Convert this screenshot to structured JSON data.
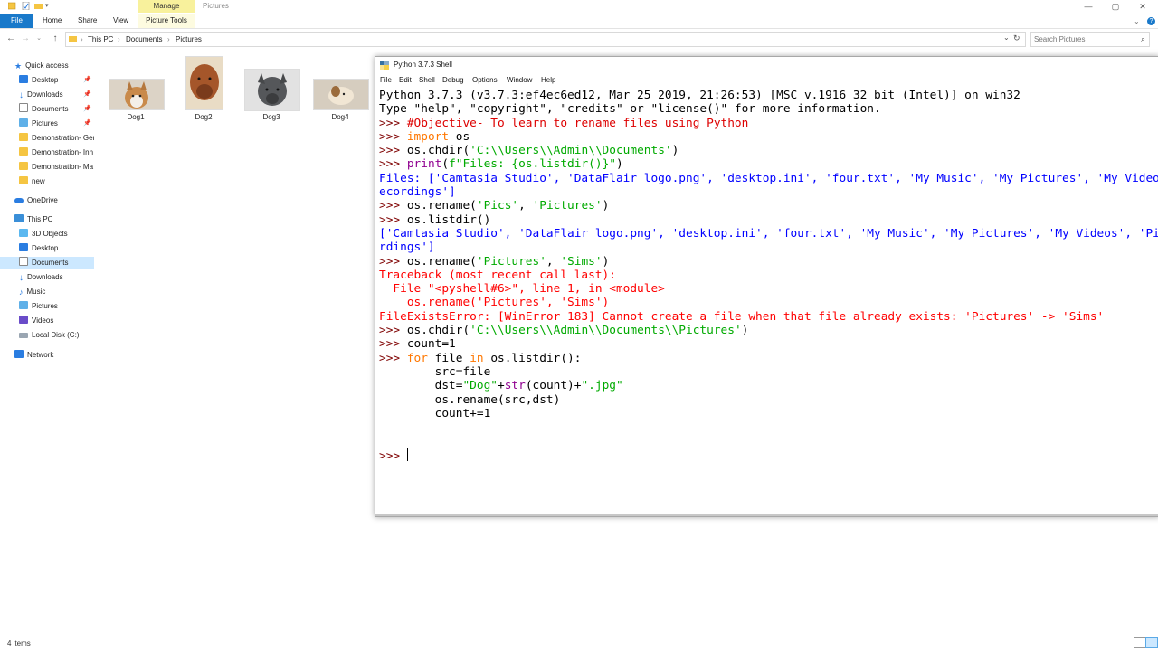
{
  "window": {
    "manage_tab": "Manage",
    "title": "Pictures",
    "controls": {
      "minimize": "—",
      "maximize": "▢",
      "close": "✕",
      "help": "?"
    }
  },
  "ribbon": {
    "file": "File",
    "home": "Home",
    "share": "Share",
    "view": "View",
    "picture_tools": "Picture Tools"
  },
  "address": {
    "crumbs": [
      "This PC",
      "Documents",
      "Pictures"
    ],
    "separator": "›"
  },
  "search": {
    "placeholder": "Search Pictures"
  },
  "sidebar": {
    "items": [
      {
        "label": "Quick access",
        "icon": "star-icon",
        "pinned": false
      },
      {
        "label": "Desktop",
        "icon": "desktop-icon",
        "pinned": true
      },
      {
        "label": "Downloads",
        "icon": "download-icon",
        "pinned": true
      },
      {
        "label": "Documents",
        "icon": "documents-icon",
        "pinned": true
      },
      {
        "label": "Pictures",
        "icon": "pictures-icon",
        "pinned": true
      },
      {
        "label": "Demonstration- Ger",
        "icon": "folder-icon",
        "pinned": false
      },
      {
        "label": "Demonstration- Inh",
        "icon": "folder-icon",
        "pinned": false
      },
      {
        "label": "Demonstration- Ma",
        "icon": "folder-icon",
        "pinned": false
      },
      {
        "label": "new",
        "icon": "folder-icon",
        "pinned": false
      },
      {
        "label": "OneDrive",
        "icon": "cloud-icon",
        "pinned": false
      },
      {
        "label": "This PC",
        "icon": "computer-icon",
        "pinned": false
      },
      {
        "label": "3D Objects",
        "icon": "cube-icon",
        "pinned": false
      },
      {
        "label": "Desktop",
        "icon": "desktop-icon",
        "pinned": false
      },
      {
        "label": "Documents",
        "icon": "documents-icon",
        "pinned": false,
        "selected": true
      },
      {
        "label": "Downloads",
        "icon": "download-icon",
        "pinned": false
      },
      {
        "label": "Music",
        "icon": "music-icon",
        "pinned": false
      },
      {
        "label": "Pictures",
        "icon": "pictures-icon",
        "pinned": false
      },
      {
        "label": "Videos",
        "icon": "video-icon",
        "pinned": false
      },
      {
        "label": "Local Disk (C:)",
        "icon": "disk-icon",
        "pinned": false
      },
      {
        "label": "Network",
        "icon": "network-icon",
        "pinned": false
      }
    ]
  },
  "files": [
    {
      "name": "Dog1"
    },
    {
      "name": "Dog2"
    },
    {
      "name": "Dog3"
    },
    {
      "name": "Dog4"
    }
  ],
  "status": {
    "count": "4 items"
  },
  "shell": {
    "title": "Python 3.7.3 Shell",
    "menu": [
      "File",
      "Edit",
      "Shell",
      "Debug",
      "Options",
      "Window",
      "Help"
    ],
    "lines": [
      {
        "segs": [
          [
            "",
            "Python 3.7.3 (v3.7.3:ef4ec6ed12, Mar 25 2019, 21:26:53) [MSC v.1916 32 bit (Intel)] on win32"
          ]
        ]
      },
      {
        "segs": [
          [
            "",
            "Type \"help\", \"copyright\", \"credits\" or \"license()\" for more information."
          ]
        ]
      },
      {
        "segs": [
          [
            "p",
            ">>> "
          ],
          [
            "cm",
            "#Objective- To learn to rename files using Python"
          ]
        ]
      },
      {
        "segs": [
          [
            "p",
            ">>> "
          ],
          [
            "kw",
            "import"
          ],
          [
            "",
            " os"
          ]
        ]
      },
      {
        "segs": [
          [
            "p",
            ">>> "
          ],
          [
            "",
            "os.chdir("
          ],
          [
            "st",
            "'C:\\\\Users\\\\Admin\\\\Documents'"
          ],
          [
            "",
            ")"
          ]
        ]
      },
      {
        "segs": [
          [
            "p",
            ">>> "
          ],
          [
            "bu",
            "print"
          ],
          [
            "",
            "("
          ],
          [
            "st",
            "f\"Files: {os.listdir()}\""
          ],
          [
            "",
            ")"
          ]
        ]
      },
      {
        "segs": [
          [
            "out",
            "Files: ['Camtasia Studio', 'DataFlair logo.png', 'desktop.ini', 'four.txt', 'My Music', 'My Pictures', 'My Videos', 'Pics', 'Sound r"
          ]
        ]
      },
      {
        "segs": [
          [
            "out",
            "ecordings']"
          ]
        ]
      },
      {
        "segs": [
          [
            "p",
            ">>> "
          ],
          [
            "",
            "os.rename("
          ],
          [
            "st",
            "'Pics'"
          ],
          [
            "",
            ", "
          ],
          [
            "st",
            "'Pictures'"
          ],
          [
            "",
            ")"
          ]
        ]
      },
      {
        "segs": [
          [
            "p",
            ">>> "
          ],
          [
            "",
            "os.listdir()"
          ]
        ]
      },
      {
        "segs": [
          [
            "out",
            "['Camtasia Studio', 'DataFlair logo.png', 'desktop.ini', 'four.txt', 'My Music', 'My Pictures', 'My Videos', 'Pictures', 'Sound reco"
          ]
        ]
      },
      {
        "segs": [
          [
            "out",
            "rdings']"
          ]
        ]
      },
      {
        "segs": [
          [
            "p",
            ">>> "
          ],
          [
            "",
            "os.rename("
          ],
          [
            "st",
            "'Pictures'"
          ],
          [
            "",
            ", "
          ],
          [
            "st",
            "'Sims'"
          ],
          [
            "",
            ")"
          ]
        ]
      },
      {
        "segs": [
          [
            "err",
            "Traceback (most recent call last):"
          ]
        ]
      },
      {
        "segs": [
          [
            "err",
            "  File \"<pyshell#6>\", line 1, in <module>"
          ]
        ]
      },
      {
        "segs": [
          [
            "err",
            "    os.rename('Pictures', 'Sims')"
          ]
        ]
      },
      {
        "segs": [
          [
            "err",
            "FileExistsError: [WinError 183] Cannot create a file when that file already exists: 'Pictures' -> 'Sims'"
          ]
        ]
      },
      {
        "segs": [
          [
            "p",
            ">>> "
          ],
          [
            "",
            "os.chdir("
          ],
          [
            "st",
            "'C:\\\\Users\\\\Admin\\\\Documents\\\\Pictures'"
          ],
          [
            "",
            ")"
          ]
        ]
      },
      {
        "segs": [
          [
            "p",
            ">>> "
          ],
          [
            "",
            "count=1"
          ]
        ]
      },
      {
        "segs": [
          [
            "p",
            ">>> "
          ],
          [
            "kw",
            "for"
          ],
          [
            "",
            " file "
          ],
          [
            "kw",
            "in"
          ],
          [
            "",
            " os.listdir():"
          ]
        ]
      },
      {
        "segs": [
          [
            "",
            "        src=file"
          ]
        ]
      },
      {
        "segs": [
          [
            "",
            "        dst="
          ],
          [
            "st",
            "\"Dog\""
          ],
          [
            "",
            "+"
          ],
          [
            "bu",
            "str"
          ],
          [
            "",
            "(count)+"
          ],
          [
            "st",
            "\".jpg\""
          ]
        ]
      },
      {
        "segs": [
          [
            "",
            "        os.rename(src,dst)"
          ]
        ]
      },
      {
        "segs": [
          [
            "",
            "        count+=1"
          ]
        ]
      },
      {
        "segs": [
          [
            "",
            ""
          ]
        ]
      },
      {
        "segs": [
          [
            "",
            ""
          ]
        ]
      },
      {
        "segs": [
          [
            "p",
            ">>> "
          ]
        ],
        "cursor": true
      }
    ]
  }
}
